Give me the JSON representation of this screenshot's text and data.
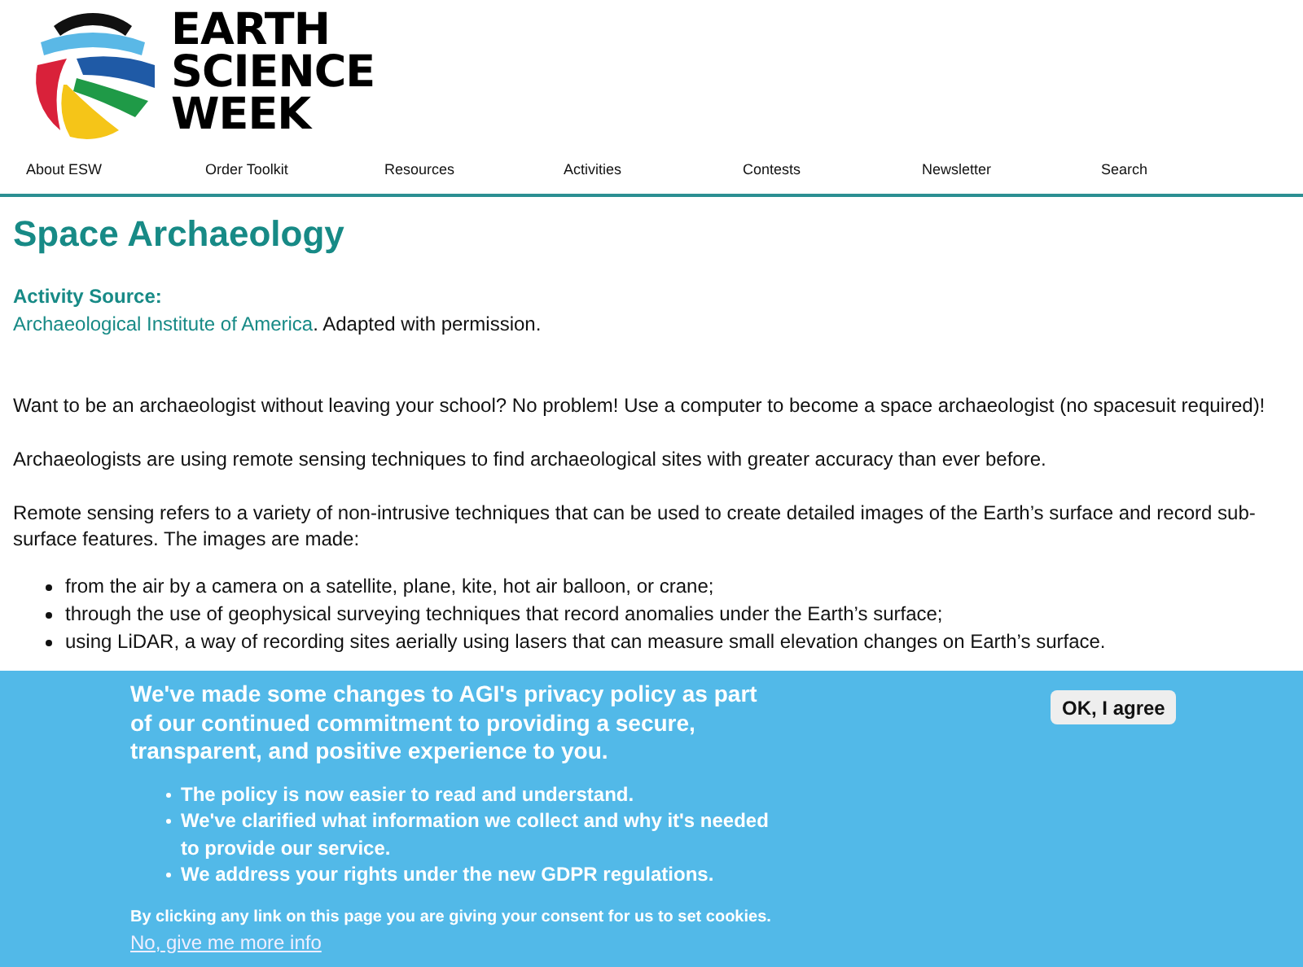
{
  "logo": {
    "lines": [
      "EARTH",
      "SCIENCE",
      "WEEK"
    ]
  },
  "nav": [
    "About ESW",
    "Order Toolkit",
    "Resources",
    "Activities",
    "Contests",
    "Newsletter",
    "Search"
  ],
  "title": "Space Archaeology",
  "source": {
    "label": "Activity Source:",
    "link": "Archaeological Institute of America",
    "rest": ". Adapted with permission."
  },
  "paragraphs": [
    "Want to be an archaeologist without leaving your school? No problem! Use a computer to become a space archaeologist (no spacesuit required)!",
    "Archaeologists are using remote sensing techniques to find archaeological sites with greater accuracy than ever before.",
    "Remote sensing refers to a variety of non-intrusive techniques that can be used to create detailed images of the Earth’s surface and record sub-surface features. The images are made:"
  ],
  "bullets": [
    "from the air by a camera on a satellite, plane, kite, hot air balloon, or crane;",
    "through the use of geophysical surveying techniques that record anomalies under the Earth’s surface;",
    "using LiDAR, a way of recording sites aerially using lasers that can measure small elevation changes on Earth’s surface."
  ],
  "banner": {
    "heading": "We've made some changes to AGI's privacy policy as part of our continued commitment to providing a secure, transparent, and positive experience to you.",
    "points": [
      "The policy is now easier to read and understand.",
      "We've clarified what information we collect and why it's needed to provide our service.",
      "We address your rights under the new GDPR regulations."
    ],
    "consent": "By clicking any link on this page you are giving your consent for us to set cookies.",
    "more_link": "No, give me more info",
    "button": "OK, I agree"
  }
}
